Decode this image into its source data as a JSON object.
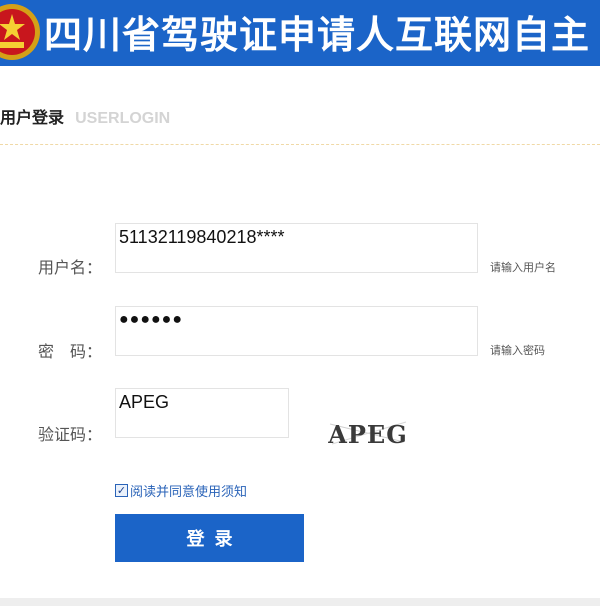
{
  "header": {
    "title": "四川省驾驶证申请人互联网自主"
  },
  "section": {
    "title": "用户登录",
    "subtitle": "USERLOGIN"
  },
  "form": {
    "username": {
      "label": "用户名：",
      "value": "51132119840218****",
      "hint": "请输入用户名"
    },
    "password": {
      "label": "密　码：",
      "value": "●●●●●●",
      "hint": "请输入密码"
    },
    "captcha": {
      "label": "验证码：",
      "value": "APEG",
      "image_text": "APEG"
    },
    "agree": {
      "checked": true,
      "text": "阅读并同意使用须知"
    },
    "login_label": "登录"
  },
  "colors": {
    "brand_blue": "#1b64c8",
    "link_blue": "#2a63b8"
  },
  "icons": {
    "emblem": "national-emblem-icon",
    "checkbox": "checkbox-checked-icon"
  }
}
